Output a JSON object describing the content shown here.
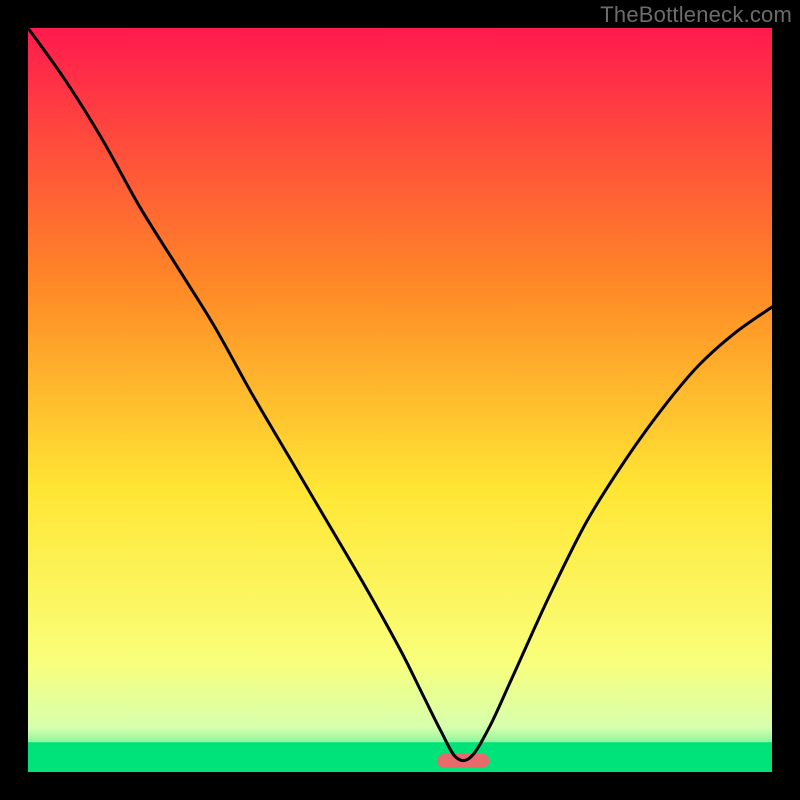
{
  "watermark": "TheBottleneck.com",
  "chart_data": {
    "type": "line",
    "title": "",
    "xlabel": "",
    "ylabel": "",
    "xlim": [
      0,
      1
    ],
    "ylim": [
      0,
      1
    ],
    "grid": false,
    "legend": false,
    "background_gradient": [
      "#ff1a4e",
      "#ff8a26",
      "#ffe634",
      "#f9ff7a",
      "#00e27a"
    ],
    "green_band_y": [
      0.0,
      0.04
    ],
    "optimum_marker": {
      "x_center": 0.585,
      "x_half_width": 0.035,
      "y": 0.015,
      "color": "#e96a6a"
    },
    "series": [
      {
        "name": "bottleneck-curve",
        "color": "#000000",
        "x": [
          0.0,
          0.05,
          0.1,
          0.15,
          0.2,
          0.25,
          0.3,
          0.35,
          0.4,
          0.45,
          0.5,
          0.53,
          0.555,
          0.575,
          0.595,
          0.62,
          0.65,
          0.7,
          0.75,
          0.8,
          0.85,
          0.9,
          0.95,
          1.0
        ],
        "y": [
          1.0,
          0.93,
          0.85,
          0.76,
          0.68,
          0.6,
          0.51,
          0.425,
          0.34,
          0.255,
          0.165,
          0.105,
          0.055,
          0.02,
          0.02,
          0.06,
          0.125,
          0.235,
          0.335,
          0.415,
          0.485,
          0.545,
          0.59,
          0.625
        ]
      }
    ]
  }
}
